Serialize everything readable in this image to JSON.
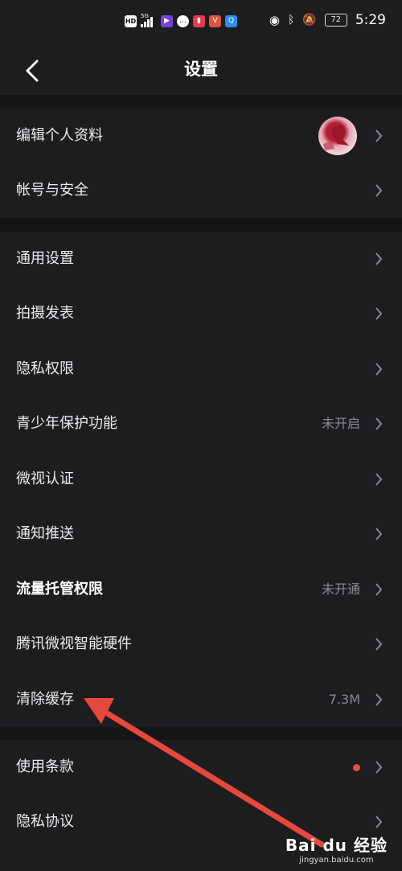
{
  "status": {
    "network_badge": "HD",
    "signal": "5G",
    "battery": "72",
    "time": "5:29"
  },
  "header": {
    "title": "设置"
  },
  "groups": [
    {
      "items": [
        {
          "label": "编辑个人资料",
          "value": ""
        },
        {
          "label": "帐号与安全",
          "value": ""
        }
      ]
    },
    {
      "items": [
        {
          "label": "通用设置",
          "value": ""
        },
        {
          "label": "拍摄发表",
          "value": ""
        },
        {
          "label": "隐私权限",
          "value": ""
        },
        {
          "label": "青少年保护功能",
          "value": "未开启"
        },
        {
          "label": "微视认证",
          "value": ""
        },
        {
          "label": "通知推送",
          "value": ""
        },
        {
          "label": "流量托管权限",
          "value": "未开通"
        },
        {
          "label": "腾讯微视智能硬件",
          "value": ""
        },
        {
          "label": "清除缓存",
          "value": "7.3M"
        }
      ]
    },
    {
      "items": [
        {
          "label": "使用条款",
          "value": ""
        },
        {
          "label": "隐私协议",
          "value": ""
        }
      ]
    }
  ],
  "watermark": {
    "logo": "Bai du 经验",
    "url": "jingyan.baidu.com"
  },
  "colors": {
    "background": "#151517",
    "row_bg": "#1d1d20",
    "annotation_arrow": "#e8473d",
    "badge_dot": "#e54c40"
  }
}
